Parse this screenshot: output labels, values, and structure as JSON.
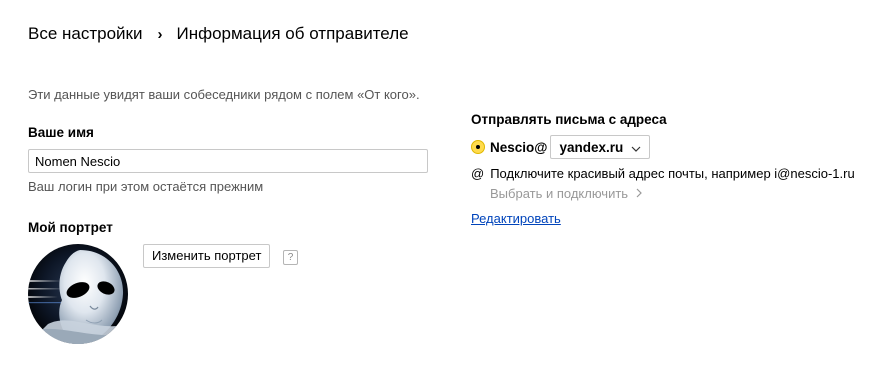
{
  "breadcrumb": {
    "root": "Все настройки",
    "separator": "›",
    "current": "Информация об отправителе"
  },
  "description": "Эти данные увидят ваши собеседники рядом с полем «От кого».",
  "name_section": {
    "label": "Ваше имя",
    "value": "Nomen Nescio",
    "hint": "Ваш логин при этом остаётся прежним"
  },
  "portrait_section": {
    "label": "Мой портрет",
    "change_button": "Изменить портрет",
    "help": "?"
  },
  "send_from": {
    "label": "Отправлять письма с адреса",
    "login": "Nescio@",
    "domain": "yandex.ru",
    "promo_icon": "@",
    "promo_text": "Подключите красивый адрес почты, например i@nescio-1.ru",
    "connect_link": "Выбрать и подключить",
    "edit_link": "Редактировать"
  },
  "colors": {
    "radio_fill": "#ffdb4d",
    "link": "#0044bb",
    "muted": "#999999"
  }
}
